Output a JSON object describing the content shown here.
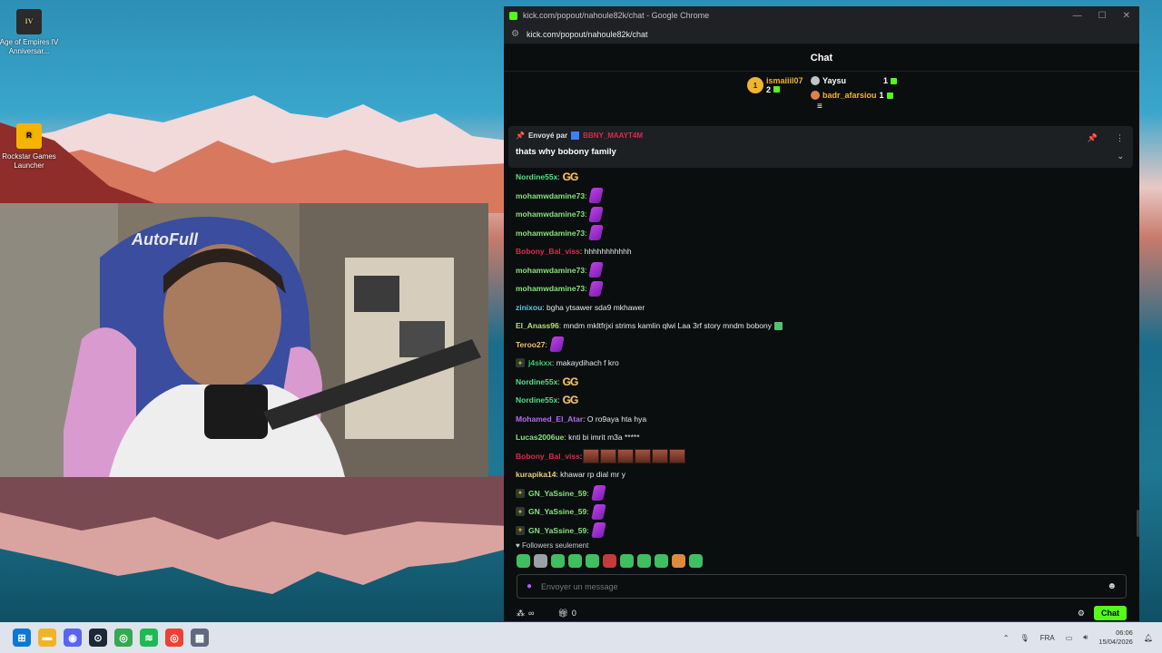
{
  "desktop": {
    "icons": [
      {
        "label": "Age of Empires IV Anniversar...",
        "glyph": "IV"
      },
      {
        "label": "Rockstar Games Launcher",
        "glyph": "R"
      }
    ]
  },
  "window": {
    "title": "kick.com/popout/nahoule82k/chat - Google Chrome",
    "url": "kick.com/popout/nahoule82k/chat"
  },
  "chat": {
    "header": "Chat",
    "leaderboard": [
      {
        "rank": "1",
        "name": "ismaiiil07",
        "count": "2"
      },
      {
        "rank": "",
        "name": "Yaysu",
        "count": "1"
      },
      {
        "rank": "",
        "name": "badr_afarsiou",
        "count": "1"
      }
    ],
    "pinned": {
      "sent_by_label": "Envoyé par",
      "sender": "BBNY_MAAYT4M",
      "message": "thats why bobony family"
    },
    "messages": [
      {
        "user": "Nordine55x",
        "color": "#4ee087",
        "text": ":",
        "emote": "gg"
      },
      {
        "user": "mohamwdamine73",
        "color": "#86e37c",
        "text": ":",
        "emote": "purple"
      },
      {
        "user": "mohamwdamine73",
        "color": "#86e37c",
        "text": ":",
        "emote": "purple"
      },
      {
        "user": "mohamwdamine73",
        "color": "#86e37c",
        "text": ":",
        "emote": "purple"
      },
      {
        "user": "Bobony_Bal_viss",
        "color": "#e0284d",
        "text": ": hhhhhhhhhhh",
        "emote": ""
      },
      {
        "user": "mohamwdamine73",
        "color": "#86e37c",
        "text": ":",
        "emote": "purple"
      },
      {
        "user": "mohamwdamine73",
        "color": "#86e37c",
        "text": ":",
        "emote": "purple"
      },
      {
        "user": "zinixou",
        "color": "#5ec8e6",
        "text": ": bgha ytsawer sda9 mkhawer",
        "emote": ""
      },
      {
        "user": "El_Anass96",
        "color": "#b7e07a",
        "text": ": mndm mkltfrjxi strims kamlin qlwi Laa 3rf story mndm bobony",
        "emote": "check"
      },
      {
        "user": "Teroo27",
        "color": "#f0c16b",
        "text": ":",
        "emote": "purple"
      },
      {
        "user": "j4skxx",
        "color": "#3ec96a",
        "text": ": makaydihach f kro",
        "emote": "",
        "badge": true
      },
      {
        "user": "Nordine55x",
        "color": "#4ee087",
        "text": ":",
        "emote": "gg"
      },
      {
        "user": "Nordine55x",
        "color": "#4ee087",
        "text": ":",
        "emote": "gg"
      },
      {
        "user": "Mohamed_El_Atar",
        "color": "#b46cf0",
        "text": ": O ro9aya hta hya",
        "emote": ""
      },
      {
        "user": "Lucas2006ue",
        "color": "#86e37c",
        "text": ": knti bi imrit m3a *****",
        "emote": ""
      },
      {
        "user": "Bobony_Bal_viss",
        "color": "#e0284d",
        "text": ":",
        "emote": "faces"
      },
      {
        "user": "kurapika14",
        "color": "#e7d07a",
        "text": ": khawar rp dial mr y",
        "emote": ""
      },
      {
        "user": "GN_YaSsine_59",
        "color": "#86e37c",
        "text": ":",
        "emote": "purple",
        "badge": true
      },
      {
        "user": "GN_YaSsine_59",
        "color": "#86e37c",
        "text": ":",
        "emote": "purple",
        "badge": true
      },
      {
        "user": "GN_YaSsine_59",
        "color": "#86e37c",
        "text": ":",
        "emote": "purple",
        "badge": true
      }
    ],
    "followers_only": "Followers seulement",
    "input_placeholder": "Envoyer un message",
    "bottom": {
      "left_count": "∞",
      "right_count": "0",
      "chat_button": "Chat"
    }
  },
  "taskbar": {
    "lang": "FRA",
    "time": "06:06",
    "date": "15/04/2026"
  }
}
